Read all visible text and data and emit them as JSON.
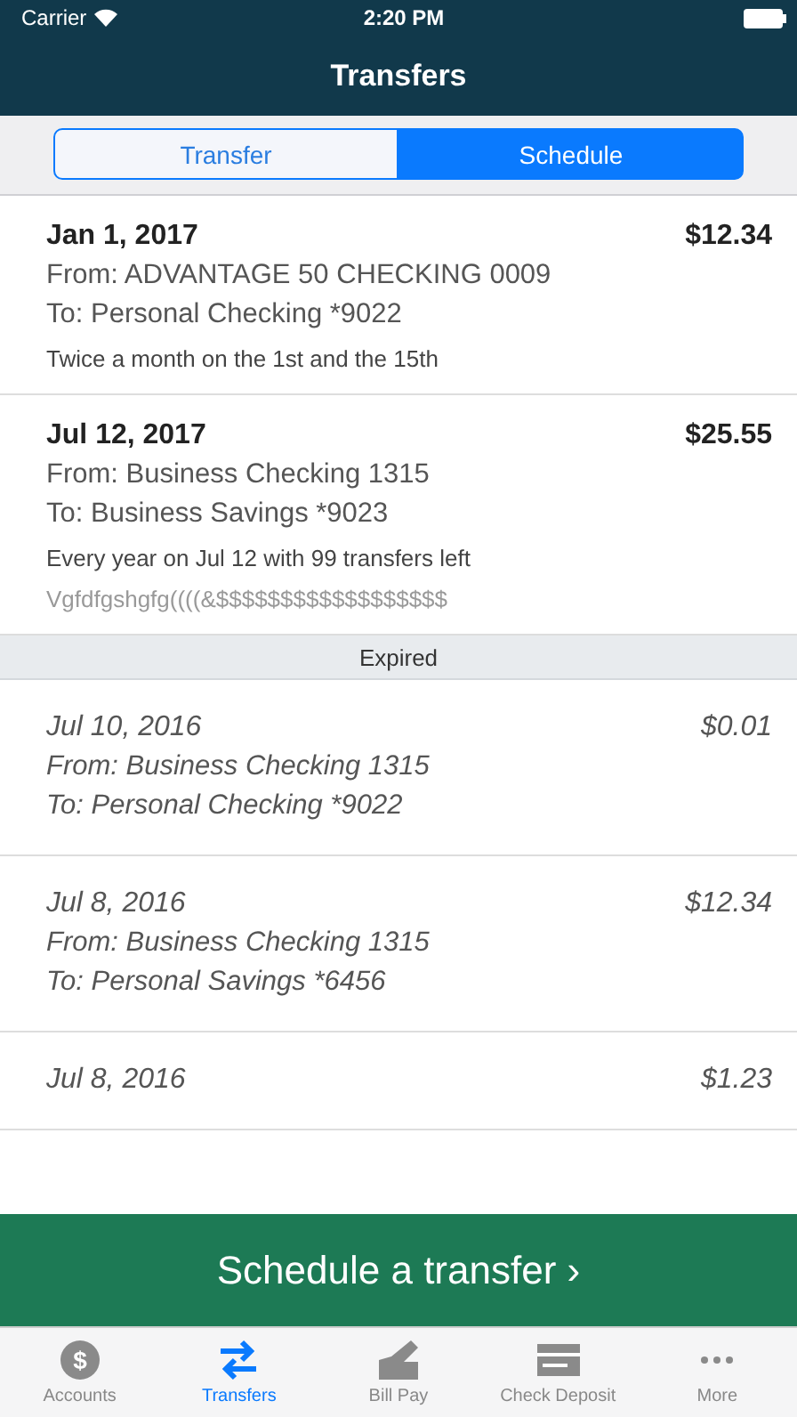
{
  "status_bar": {
    "carrier": "Carrier",
    "time": "2:20 PM"
  },
  "nav_bar": {
    "title": "Transfers"
  },
  "segments": [
    {
      "label": "Transfer",
      "selected": false
    },
    {
      "label": "Schedule",
      "selected": true
    }
  ],
  "transfers": [
    {
      "kind": "active",
      "date": "Jan 1, 2017",
      "amount": "$12.34",
      "from": "From: ADVANTAGE 50 CHECKING 0009",
      "to": "To: Personal Checking *9022",
      "schedule": "Twice a month on the 1st and the 15th"
    },
    {
      "kind": "active",
      "date": "Jul 12, 2017",
      "amount": "$25.55",
      "from": "From: Business Checking 1315",
      "to": "To: Business Savings *9023",
      "schedule": "Every year on Jul 12 with 99 transfers left",
      "memo": "Vgfdfgshgfg((((&$$$$$$$$$$$$$$$$$$"
    },
    {
      "kind": "header",
      "label": "Expired"
    },
    {
      "kind": "expired",
      "date": "Jul 10, 2016",
      "amount": "$0.01",
      "from": "From: Business Checking 1315",
      "to": "To: Personal Checking *9022"
    },
    {
      "kind": "expired",
      "date": "Jul 8, 2016",
      "amount": "$12.34",
      "from": "From: Business Checking 1315",
      "to": "To: Personal Savings *6456"
    },
    {
      "kind": "expired",
      "date": "Jul 8, 2016",
      "amount": "$1.23"
    }
  ],
  "action_button": "Schedule a transfer ›",
  "tab_bar": [
    {
      "label": "Accounts",
      "kind": "dollar",
      "glyph": "$",
      "selected": false
    },
    {
      "label": "Transfers",
      "kind": "arrows",
      "selected": true
    },
    {
      "label": "Bill Pay",
      "kind": "envelope",
      "selected": false
    },
    {
      "label": "Check Deposit",
      "kind": "check",
      "selected": false
    },
    {
      "label": "More",
      "kind": "dots",
      "selected": false
    }
  ]
}
